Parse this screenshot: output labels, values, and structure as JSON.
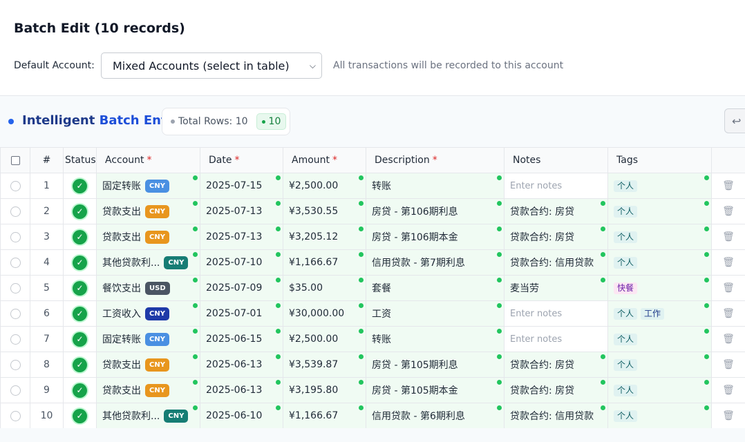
{
  "header": {
    "title": "Batch Edit (10 records)"
  },
  "account_selector": {
    "label": "Default Account:",
    "value": "Mixed Accounts (select in table)",
    "hint": "All transactions will be recorded to this account"
  },
  "panel": {
    "title_prefix": "Intelligent",
    "title_suffix": "Batch Entry",
    "total_rows_label": "Total Rows: 10",
    "valid_count": "10",
    "undo_icon": "undo-icon"
  },
  "columns": {
    "index": "#",
    "status": "Status",
    "account": "Account",
    "date": "Date",
    "amount": "Amount",
    "description": "Description",
    "notes": "Notes",
    "tags": "Tags",
    "required_mark": "*"
  },
  "notes_placeholder": "Enter notes",
  "currency_colors": {
    "CNY_light": "#4a90e2",
    "CNY_orange": "#e8961e",
    "CNY_teal": "#167d74",
    "CNY_navy": "#1e3aa8",
    "USD": "#4b5563"
  },
  "rows": [
    {
      "n": "1",
      "account": "固定转账",
      "currency": "CNY",
      "cur_style": "CNY_light",
      "date": "2025-07-15",
      "amount": "¥2,500.00",
      "description": "转账",
      "notes": "",
      "tags": [
        "个人"
      ]
    },
    {
      "n": "2",
      "account": "贷款支出",
      "currency": "CNY",
      "cur_style": "CNY_orange",
      "date": "2025-07-13",
      "amount": "¥3,530.55",
      "description": "房贷 - 第106期利息",
      "notes": "贷款合约: 房贷",
      "tags": [
        "个人"
      ]
    },
    {
      "n": "3",
      "account": "贷款支出",
      "currency": "CNY",
      "cur_style": "CNY_orange",
      "date": "2025-07-13",
      "amount": "¥3,205.12",
      "description": "房贷 - 第106期本金",
      "notes": "贷款合约: 房贷",
      "tags": [
        "个人"
      ]
    },
    {
      "n": "4",
      "account": "其他贷款利...",
      "currency": "CNY",
      "cur_style": "CNY_teal",
      "date": "2025-07-10",
      "amount": "¥1,166.67",
      "description": "信用贷款 - 第7期利息",
      "notes": "贷款合约: 信用贷款",
      "tags": [
        "个人"
      ]
    },
    {
      "n": "5",
      "account": "餐饮支出",
      "currency": "USD",
      "cur_style": "USD",
      "date": "2025-07-09",
      "amount": "$35.00",
      "description": "套餐",
      "notes": "麦当劳",
      "tags": [
        "快餐"
      ]
    },
    {
      "n": "6",
      "account": "工资收入",
      "currency": "CNY",
      "cur_style": "CNY_navy",
      "date": "2025-07-01",
      "amount": "¥30,000.00",
      "description": "工资",
      "notes": "",
      "tags": [
        "个人",
        "工作"
      ]
    },
    {
      "n": "7",
      "account": "固定转账",
      "currency": "CNY",
      "cur_style": "CNY_light",
      "date": "2025-06-15",
      "amount": "¥2,500.00",
      "description": "转账",
      "notes": "",
      "tags": [
        "个人"
      ]
    },
    {
      "n": "8",
      "account": "贷款支出",
      "currency": "CNY",
      "cur_style": "CNY_orange",
      "date": "2025-06-13",
      "amount": "¥3,539.87",
      "description": "房贷 - 第105期利息",
      "notes": "贷款合约: 房贷",
      "tags": [
        "个人"
      ]
    },
    {
      "n": "9",
      "account": "贷款支出",
      "currency": "CNY",
      "cur_style": "CNY_orange",
      "date": "2025-06-13",
      "amount": "¥3,195.80",
      "description": "房贷 - 第105期本金",
      "notes": "贷款合约: 房贷",
      "tags": [
        "个人"
      ]
    },
    {
      "n": "10",
      "account": "其他贷款利...",
      "currency": "CNY",
      "cur_style": "CNY_teal",
      "date": "2025-06-10",
      "amount": "¥1,166.67",
      "description": "信用贷款 - 第6期利息",
      "notes": "贷款合约: 信用贷款",
      "tags": [
        "个人"
      ]
    }
  ]
}
